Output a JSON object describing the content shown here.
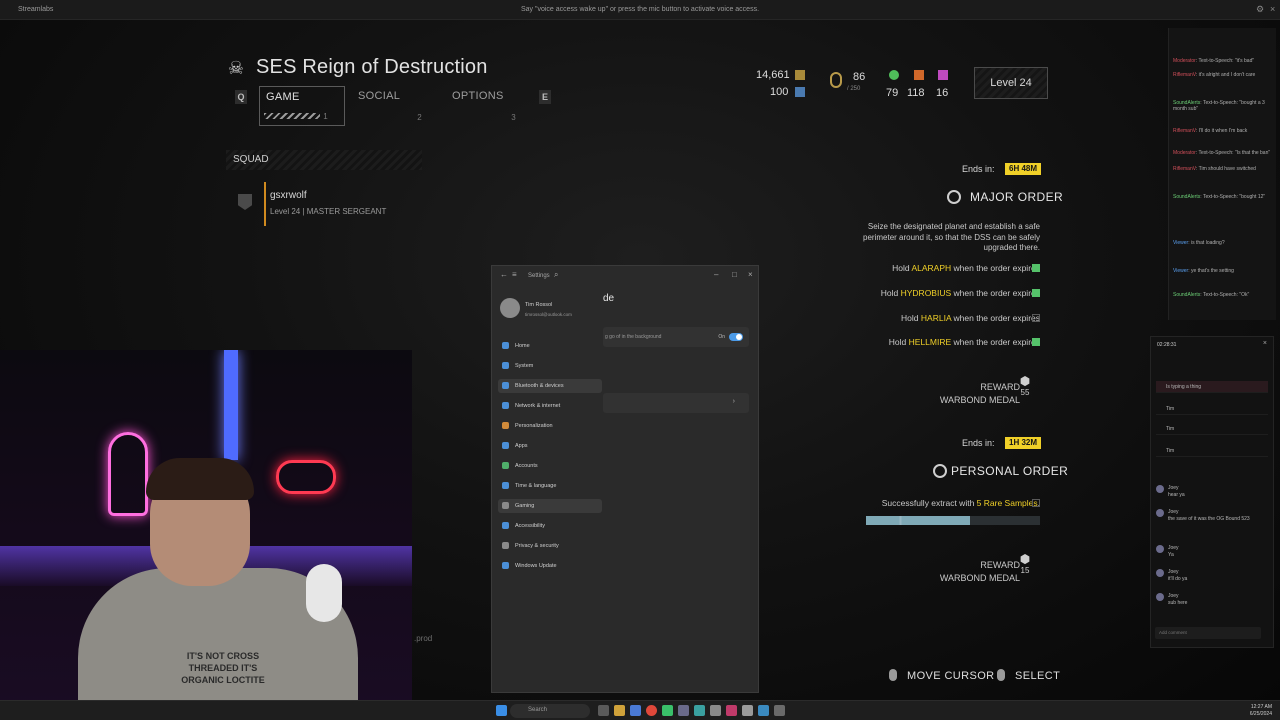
{
  "topbar": {
    "app_title": "Streamlabs",
    "voice_hint": "Say \"voice access wake up\" or press the mic button to activate voice access."
  },
  "game": {
    "ship_name": "SES Reign of Destruction",
    "tab_prev_key": "Q",
    "tab_next_key": "E",
    "tabs": [
      {
        "label": "GAME",
        "num": "1"
      },
      {
        "label": "SOCIAL",
        "num": "2"
      },
      {
        "label": "OPTIONS",
        "num": "3"
      }
    ],
    "squad": {
      "header": "SQUAD",
      "member_name": "gsxrwolf",
      "member_rank": "Level 24 | MASTER SERGEANT"
    },
    "resources": {
      "req_slips": "14,661",
      "super_credits": "100",
      "medals": "86",
      "medals_cap": "/ 250",
      "common": "79",
      "rare": "118",
      "super": "16",
      "level": "Level 24"
    },
    "major_order": {
      "ends_label": "Ends in:",
      "ends_value": "6H 48M",
      "title": "MAJOR ORDER",
      "description": "Seize the designated planet and establish a safe perimeter around it, so that the DSS can be safely upgraded there.",
      "objectives": [
        {
          "prefix": "Hold",
          "planet": "ALARAPH",
          "suffix": "when the order expires",
          "done": true
        },
        {
          "prefix": "Hold",
          "planet": "HYDROBIUS",
          "suffix": "when the order expires",
          "done": true
        },
        {
          "prefix": "Hold",
          "planet": "HARLIA",
          "suffix": "when the order expires",
          "done": false
        },
        {
          "prefix": "Hold",
          "planet": "HELLMIRE",
          "suffix": "when the order expires",
          "done": true
        }
      ],
      "reward_label": "REWARD",
      "reward_name": "WARBOND MEDAL",
      "reward_amount": "55"
    },
    "personal_order": {
      "ends_label": "Ends in:",
      "ends_value": "1H 32M",
      "title": "PERSONAL ORDER",
      "objective_prefix": "Successfully extract with",
      "objective_highlight": "5 Rare Samples",
      "progress_fraction": 0.6,
      "reward_label": "REWARD",
      "reward_name": "WARBOND MEDAL",
      "reward_amount": "15"
    },
    "hints": {
      "move": "MOVE CURSOR",
      "select": "SELECT"
    },
    "prod_text": ".prod"
  },
  "webcam": {
    "shirt_text": "IT'S NOT CROSS THREADED IT'S ORGANIC LOCTITE"
  },
  "settings": {
    "window_title": "Settings",
    "user_name": "Tim Rossol",
    "user_email": "timrossol@outlook.com",
    "heading": "de",
    "row1_text": "g go of in the background",
    "toggle_label": "On",
    "nav": [
      "Home",
      "System",
      "Bluetooth & devices",
      "Network & internet",
      "Personalization",
      "Apps",
      "Accounts",
      "Time & language",
      "Gaming",
      "Accessibility",
      "Privacy & security",
      "Windows Update"
    ]
  },
  "chat": {
    "lines": [
      {
        "user": "Moderator",
        "text": "Text-to-Speech: \"it's bad\""
      },
      {
        "user": "RiflemanV",
        "text": "it's alright and I don't care"
      },
      {
        "user": "SoundAlerts",
        "text": "Text-to-Speech: \"bought a 3 month sub\""
      },
      {
        "user": "RiflemanV",
        "text": "I'll do it when I'm back"
      },
      {
        "user": "Moderator",
        "text": "Text-to-Speech: \"Is that the ban\""
      },
      {
        "user": "RiflemanV",
        "text": "Tim should have switched"
      },
      {
        "user": "SoundAlerts",
        "text": "Text-to-Speech: \"bought 12\""
      },
      {
        "user": "Viewer",
        "text": "is that loading?"
      },
      {
        "user": "Viewer",
        "text": "ye that's the setting"
      },
      {
        "user": "SoundAlerts",
        "text": "Text-to-Speech: \"Ok\""
      }
    ],
    "panel_header": "02:28:31",
    "panel_items": [
      "Is typing a thing",
      "Tim",
      "Tim",
      "Tim"
    ],
    "panel_messages": [
      {
        "name": "Joey",
        "text": "hear ya"
      },
      {
        "name": "Joey",
        "text": "the save of it was the OG Bound 523"
      },
      {
        "name": "Joey",
        "text": "Ya"
      },
      {
        "name": "Joey",
        "text": "it'll do ya"
      },
      {
        "name": "Joey",
        "text": "sub here"
      }
    ],
    "input_placeholder": "Add comment"
  },
  "taskbar": {
    "search": "Search",
    "time": "12:27 AM",
    "date": "6/25/2024"
  },
  "colors": {
    "accent_yellow": "#f0d028",
    "objective_green": "#55c26a",
    "toggle_blue": "#4c9be8"
  }
}
